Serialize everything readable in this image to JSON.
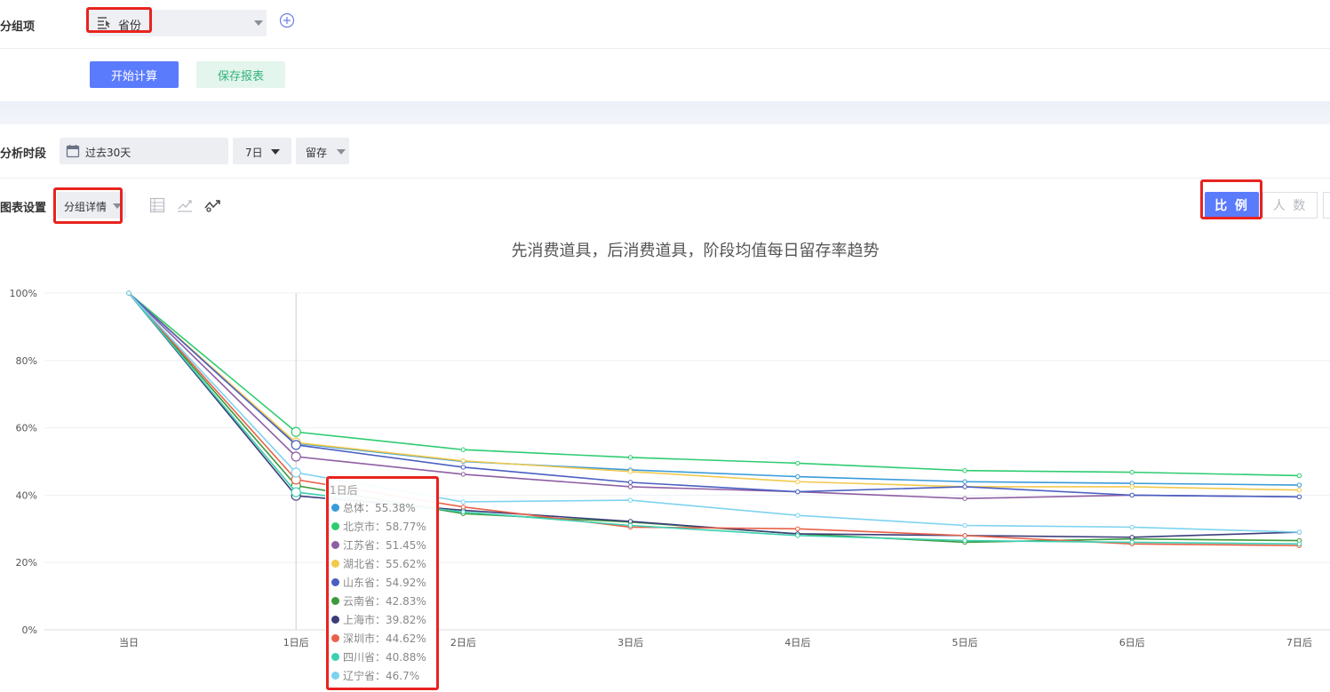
{
  "group_row": {
    "label": "分组项",
    "selected": "省份"
  },
  "actions": {
    "start_label": "开始计算",
    "save_label": "保存报表"
  },
  "period_row": {
    "label": "分析时段",
    "date_range": "过去30天",
    "days": "7日",
    "metric": "留存"
  },
  "chart_settings": {
    "label": "图表设置",
    "mode": "分组详情"
  },
  "view_toggle": {
    "ratio_label": "比 例",
    "count_label": "人 数"
  },
  "chart_data": {
    "type": "line",
    "title": "先消费道具，后消费道具，阶段均值每日留存率趋势",
    "categories": [
      "当日",
      "1日后",
      "2日后",
      "3日后",
      "4日后",
      "5日后",
      "6日后",
      "7日后"
    ],
    "yticks": [
      "0%",
      "20%",
      "40%",
      "60%",
      "80%",
      "100%"
    ],
    "ylim": [
      0,
      100
    ],
    "grid": true,
    "series": [
      {
        "name": "总体",
        "color": "#3a9bd9",
        "values": [
          100,
          55.38,
          50,
          47.5,
          45.5,
          44,
          43.5,
          43
        ]
      },
      {
        "name": "北京市",
        "color": "#2ecc71",
        "values": [
          100,
          58.77,
          53.5,
          51.2,
          49.5,
          47.3,
          46.8,
          45.8
        ]
      },
      {
        "name": "江苏省",
        "color": "#8e5ea2",
        "values": [
          100,
          51.45,
          46.2,
          42.5,
          41,
          39,
          40,
          39.5
        ]
      },
      {
        "name": "湖北省",
        "color": "#f2c94c",
        "values": [
          100,
          55.62,
          50.2,
          47,
          44,
          42.5,
          42.5,
          41.5
        ]
      },
      {
        "name": "山东省",
        "color": "#4a5fc1",
        "values": [
          100,
          54.92,
          48.3,
          43.8,
          41,
          42.5,
          40,
          39.5
        ]
      },
      {
        "name": "云南省",
        "color": "#3c9a3c",
        "values": [
          100,
          42.83,
          34.5,
          32,
          28.5,
          26,
          27,
          26.5
        ]
      },
      {
        "name": "上海市",
        "color": "#3b3d7a",
        "values": [
          100,
          39.82,
          35.5,
          32.2,
          28.5,
          28,
          27.5,
          29
        ]
      },
      {
        "name": "深圳市",
        "color": "#e8624a",
        "values": [
          100,
          44.62,
          36.5,
          30.5,
          30,
          28,
          25.5,
          25
        ]
      },
      {
        "name": "四川省",
        "color": "#3ccfb0",
        "values": [
          100,
          40.88,
          35,
          31,
          28,
          26.5,
          26,
          25.5
        ]
      },
      {
        "name": "辽宁省",
        "color": "#7dd3f0",
        "values": [
          100,
          46.7,
          38,
          38.5,
          34,
          31,
          30.5,
          29
        ]
      }
    ],
    "tooltip_index": 1,
    "tooltip_header": "1日后",
    "tooltip_items": [
      {
        "label": "总体：55.38%",
        "color": "#3a9bd9"
      },
      {
        "label": "北京市：58.77%",
        "color": "#2ecc71"
      },
      {
        "label": "江苏省：51.45%",
        "color": "#8e5ea2"
      },
      {
        "label": "湖北省：55.62%",
        "color": "#f2c94c"
      },
      {
        "label": "山东省：54.92%",
        "color": "#4a5fc1"
      },
      {
        "label": "云南省：42.83%",
        "color": "#3c9a3c"
      },
      {
        "label": "上海市：39.82%",
        "color": "#3b3d7a"
      },
      {
        "label": "深圳市：44.62%",
        "color": "#e8624a"
      },
      {
        "label": "四川省：40.88%",
        "color": "#3ccfb0"
      },
      {
        "label": "辽宁省：46.7%",
        "color": "#7dd3f0"
      }
    ]
  }
}
